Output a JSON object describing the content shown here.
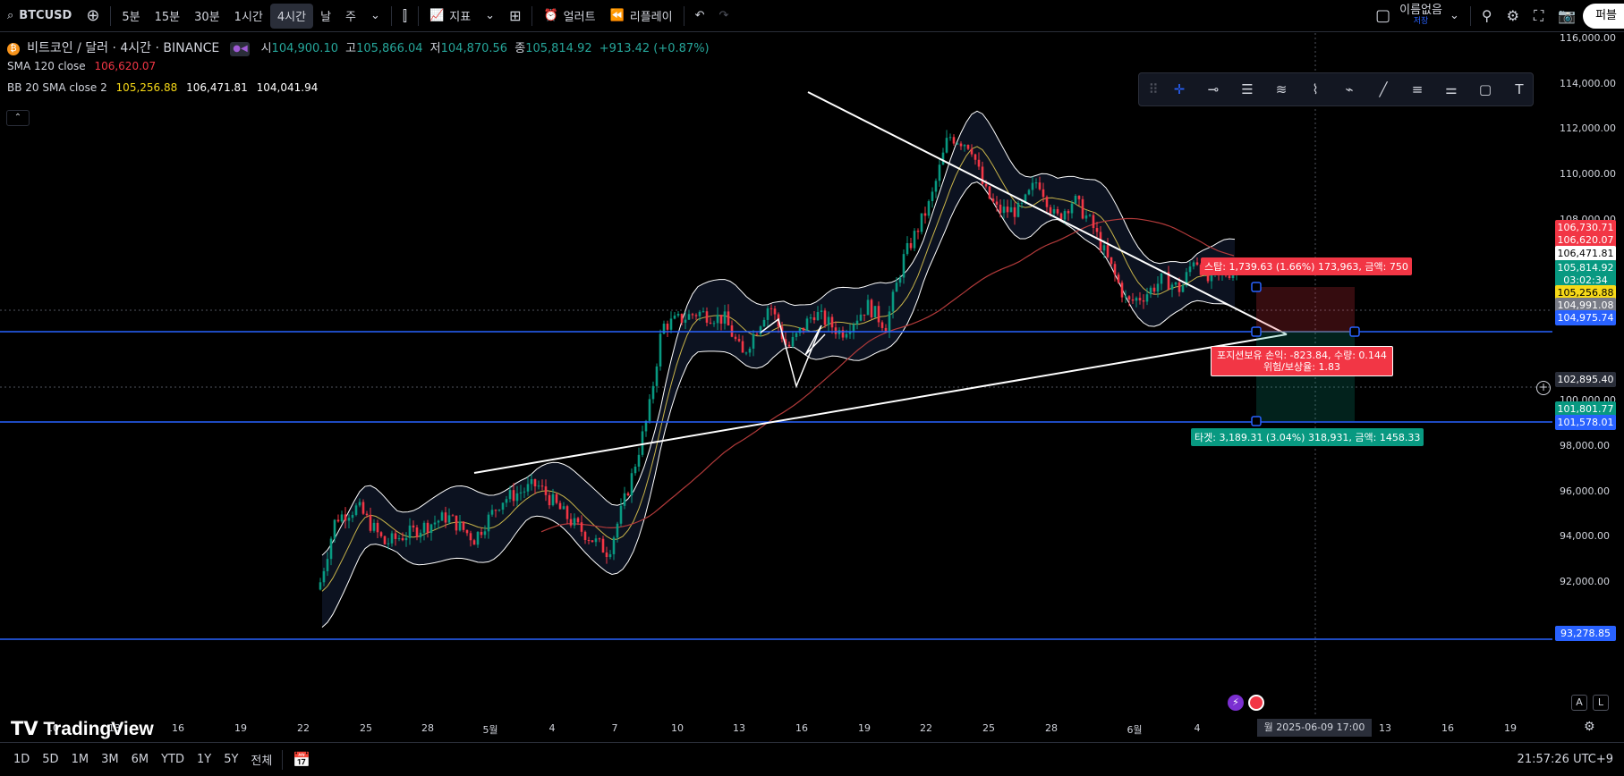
{
  "topbar": {
    "symbol": "BTCUSD",
    "intervals": [
      "5분",
      "15분",
      "30분",
      "1시간",
      "4시간",
      "날",
      "주"
    ],
    "active_interval": "4시간",
    "indicators_label": "지표",
    "alerts_label": "얼러트",
    "replay_label": "리플레이",
    "layout_name": "이름없음",
    "layout_status": "저장",
    "publish_label": "퍼블"
  },
  "legend": {
    "title": "비트코인 / 달러 · 4시간 · BINANCE",
    "o_label": "시",
    "o": "104,900.10",
    "h_label": "고",
    "h": "105,866.04",
    "l_label": "저",
    "l": "104,870.56",
    "c_label": "종",
    "c": "105,814.92",
    "change": "+913.42 (+0.87%)",
    "sma_label": "SMA 120 close",
    "sma_value": "106,620.07",
    "bb_label": "BB 20 SMA close 2",
    "bb_mid": "105,256.88",
    "bb_up": "106,471.81",
    "bb_low": "104,041.94"
  },
  "price_axis": [
    "116,000.00",
    "114,000.00",
    "112,000.00",
    "110,000.00",
    "108,000.00",
    "100,000.00",
    "98,000.00",
    "96,000.00",
    "94,000.00",
    "92,000.00"
  ],
  "price_tags": [
    {
      "text": "106,730.71",
      "bg": "#f23645"
    },
    {
      "text": "106,620.07",
      "bg": "#f23645"
    },
    {
      "text": "106,471.81",
      "bg": "#ffffff",
      "fg": "#000000"
    },
    {
      "text": "105,814.92",
      "bg": "#089981"
    },
    {
      "text": "03:02:34",
      "bg": "#089981"
    },
    {
      "text": "105,256.88",
      "bg": "#f7d917",
      "fg": "#000000"
    },
    {
      "text": "104,991.08",
      "bg": "#787b86"
    },
    {
      "text": "104,975.74",
      "bg": "#2962ff"
    },
    {
      "text": "102,895.40",
      "bg": "#2a2e39"
    },
    {
      "text": "101,801.77",
      "bg": "#089981"
    },
    {
      "text": "101,578.01",
      "bg": "#2962ff"
    },
    {
      "text": "93,278.85",
      "bg": "#2962ff"
    }
  ],
  "time_axis": [
    "10",
    "13",
    "16",
    "19",
    "22",
    "25",
    "28",
    "5월",
    "4",
    "7",
    "10",
    "13",
    "16",
    "19",
    "22",
    "25",
    "28",
    "6월",
    "4",
    "13",
    "16",
    "19"
  ],
  "crosshair_time": "월 2025-06-09   17:00",
  "position": {
    "stop_label": "스탑: 1,739.63 (1.66%) 173,963, 금액: 750",
    "pnl_line1": "포지션보유 손익: -823.84, 수량: 0.144",
    "pnl_line2": "위험/보상율: 1.83",
    "target_label": "타겟: 3,189.31 (3.04%) 318,931, 금액: 1458.33"
  },
  "ranges": [
    "1D",
    "5D",
    "1M",
    "3M",
    "6M",
    "YTD",
    "1Y",
    "5Y",
    "전체"
  ],
  "clock": "21:57:26 UTC+9",
  "brand": "TradingView",
  "scale_buttons": [
    "A",
    "L"
  ],
  "colors": {
    "up": "#089981",
    "down": "#f23645",
    "hline": "#2962ff",
    "bb": "#ffffff",
    "sma": "#b23a3a",
    "basis": "#c8b44a"
  }
}
